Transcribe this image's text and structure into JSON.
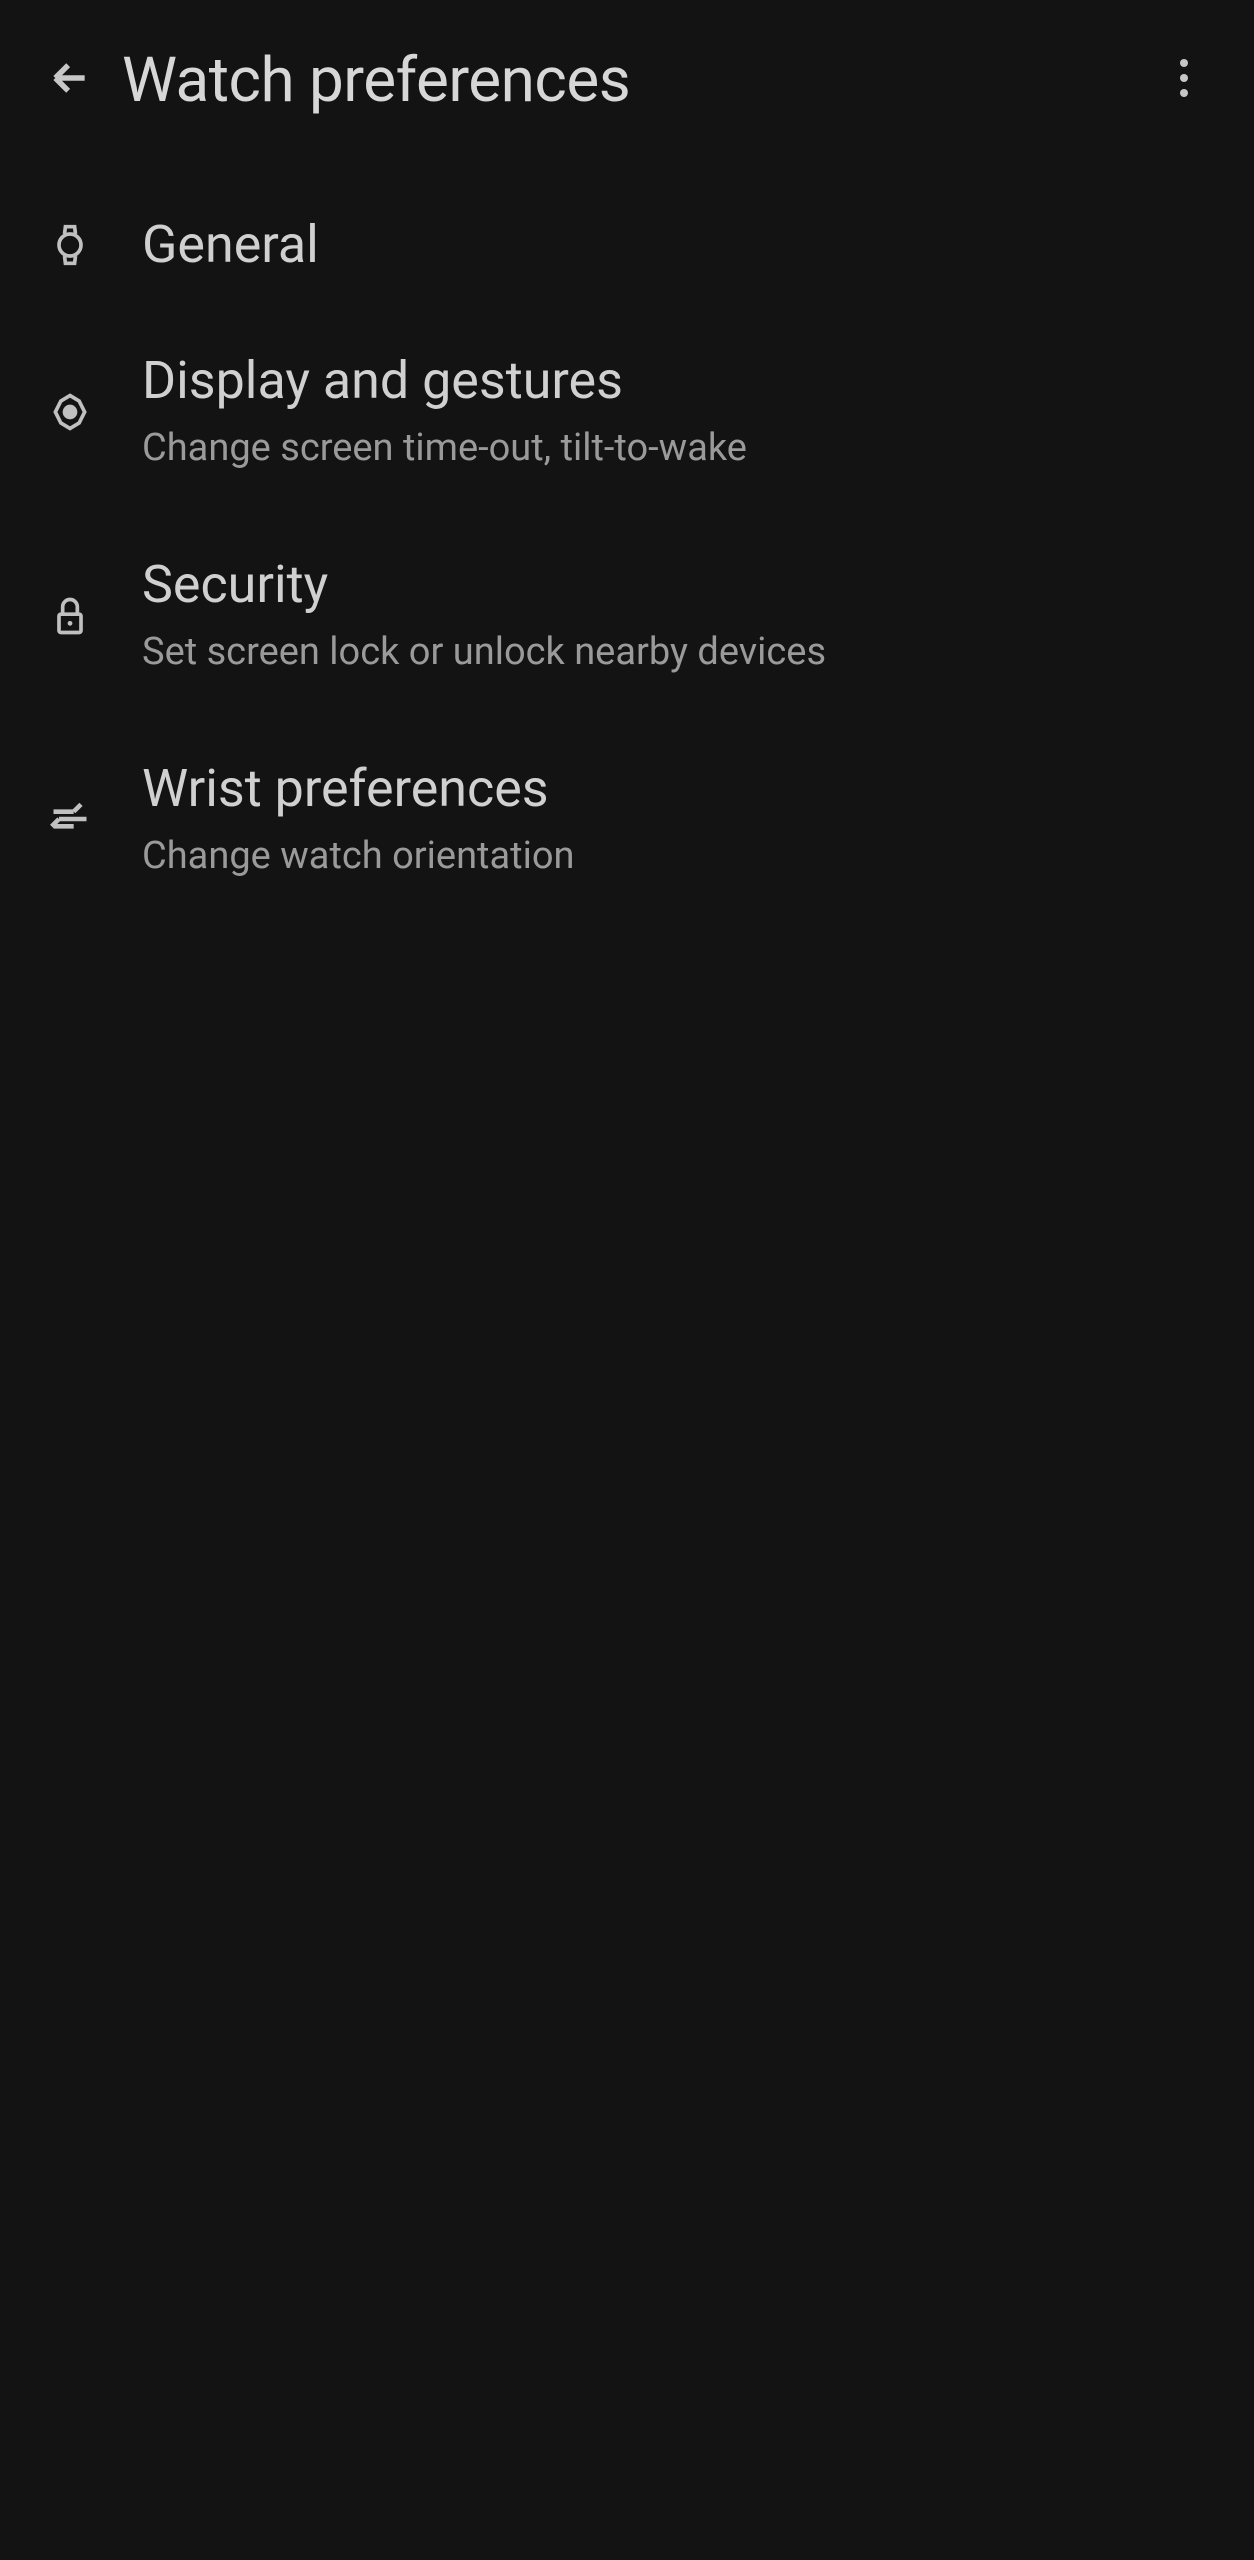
{
  "header": {
    "title": "Watch preferences"
  },
  "items": [
    {
      "title": "General",
      "subtitle": ""
    },
    {
      "title": "Display and gestures",
      "subtitle": "Change screen time-out, tilt-to-wake"
    },
    {
      "title": "Security",
      "subtitle": "Set screen lock or unlock nearby devices"
    },
    {
      "title": "Wrist preferences",
      "subtitle": "Change watch orientation"
    }
  ]
}
